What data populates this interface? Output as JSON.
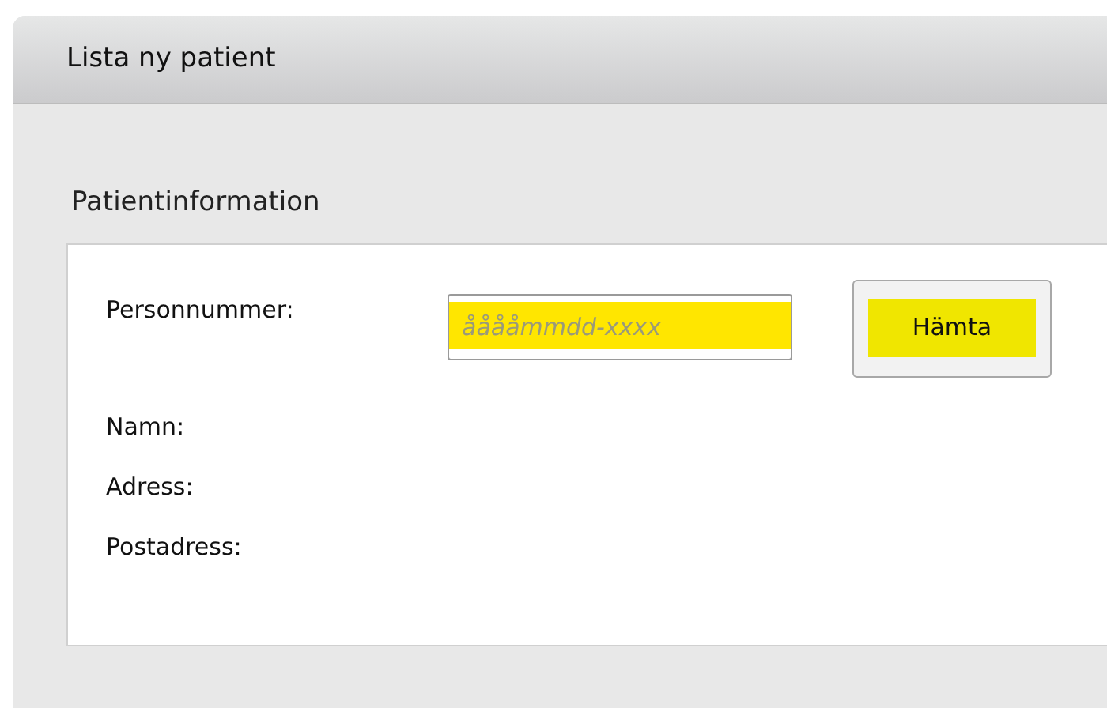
{
  "window": {
    "title": "Lista ny patient"
  },
  "section": {
    "title": "Patientinformation"
  },
  "personnummer": {
    "label": "Personnummer:",
    "placeholder": "ååååmmdd-xxxx",
    "highlighted": true
  },
  "fetch_button": {
    "label": "Hämta",
    "highlighted": true
  },
  "fields": [
    {
      "label": "Namn:"
    },
    {
      "label": "Adress:"
    },
    {
      "label": "Postadress:"
    }
  ]
}
